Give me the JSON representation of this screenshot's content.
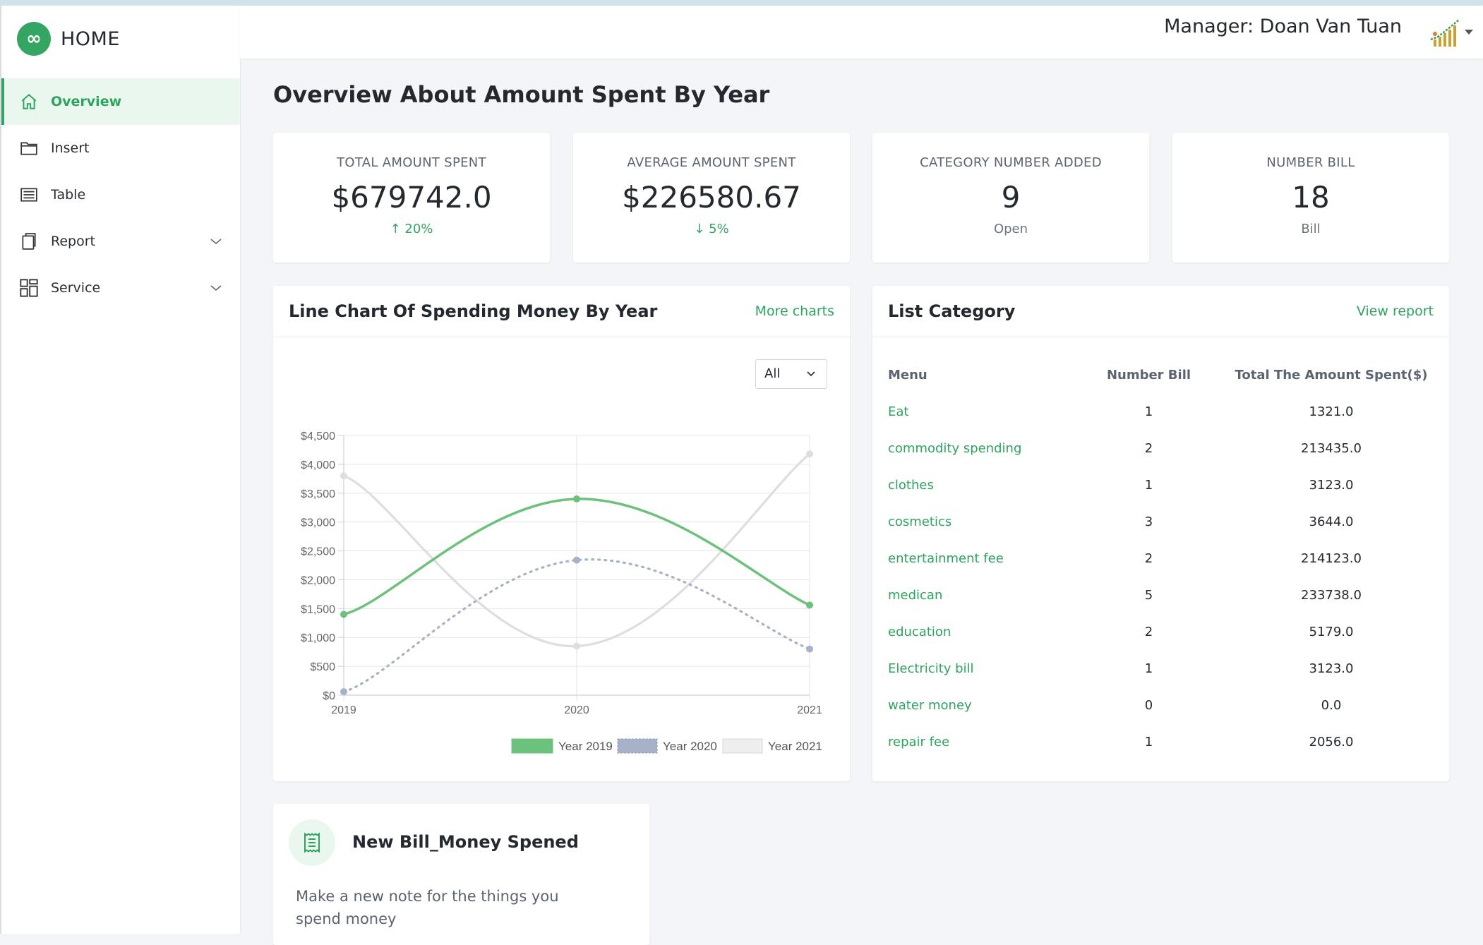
{
  "sidebar": {
    "brand": "HOME",
    "items": [
      {
        "label": "Overview"
      },
      {
        "label": "Insert"
      },
      {
        "label": "Table"
      },
      {
        "label": "Report"
      },
      {
        "label": "Service"
      }
    ]
  },
  "header": {
    "manager": "Manager: Doan Van Tuan"
  },
  "page": {
    "title": "Overview About Amount Spent By Year"
  },
  "stats": [
    {
      "label": "TOTAL AMOUNT SPENT",
      "value": "$679742.0",
      "sub": "↑ 20%"
    },
    {
      "label": "AVERAGE AMOUNT SPENT",
      "value": "$226580.67",
      "sub": "↓ 5%"
    },
    {
      "label": "CATEGORY NUMBER ADDED",
      "value": "9",
      "sub": "Open"
    },
    {
      "label": "NUMBER BILL",
      "value": "18",
      "sub": "Bill"
    }
  ],
  "chart_panel": {
    "title": "Line Chart Of Spending Money By Year",
    "link": "More charts",
    "filter": "All"
  },
  "chart_data": {
    "type": "line",
    "x": [
      "2019",
      "2020",
      "2021"
    ],
    "ylim": [
      0,
      4500
    ],
    "yticks": [
      "$0",
      "$500",
      "$1,000",
      "$1,500",
      "$2,000",
      "$2,500",
      "$3,000",
      "$3,500",
      "$4,000",
      "$4,500"
    ],
    "series": [
      {
        "name": "Year 2019",
        "values": [
          1400,
          3400,
          1560
        ],
        "color": "#6cc17d"
      },
      {
        "name": "Year 2020",
        "values": [
          60,
          2340,
          800
        ],
        "color": "#a7b1c8"
      },
      {
        "name": "Year 2021",
        "values": [
          3800,
          850,
          4180
        ],
        "color": "#dedede"
      }
    ],
    "grid": true,
    "legend": "bottom"
  },
  "category_panel": {
    "title": "List Category",
    "link": "View report",
    "headers": [
      "Menu",
      "Number Bill",
      "Total The Amount Spent($)"
    ],
    "rows": [
      [
        "Eat",
        "1",
        "1321.0"
      ],
      [
        "commodity spending",
        "2",
        "213435.0"
      ],
      [
        "clothes",
        "1",
        "3123.0"
      ],
      [
        "cosmetics",
        "3",
        "3644.0"
      ],
      [
        "entertainment fee",
        "2",
        "214123.0"
      ],
      [
        "medican",
        "5",
        "233738.0"
      ],
      [
        "education",
        "2",
        "5179.0"
      ],
      [
        "Electricity bill",
        "1",
        "3123.0"
      ],
      [
        "water money",
        "0",
        "0.0"
      ],
      [
        "repair fee",
        "1",
        "2056.0"
      ]
    ]
  },
  "bill_card": {
    "title": "New Bill_Money Spened",
    "desc": "Make a new note for the things you spend money"
  }
}
